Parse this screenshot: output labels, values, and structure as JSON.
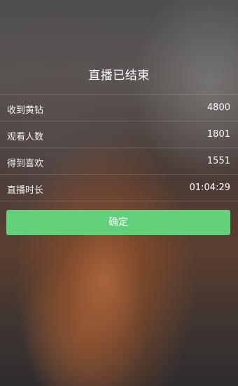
{
  "dialog": {
    "title": "直播已结束",
    "stats": [
      {
        "label": "收到黄钻",
        "value": "4800"
      },
      {
        "label": "观看人数",
        "value": "1801"
      },
      {
        "label": "得到喜欢",
        "value": "1551"
      },
      {
        "label": "直播时长",
        "value": "01:04:29"
      }
    ],
    "confirm_label": "确定"
  },
  "colors": {
    "confirm_button": "#62cf7a"
  }
}
